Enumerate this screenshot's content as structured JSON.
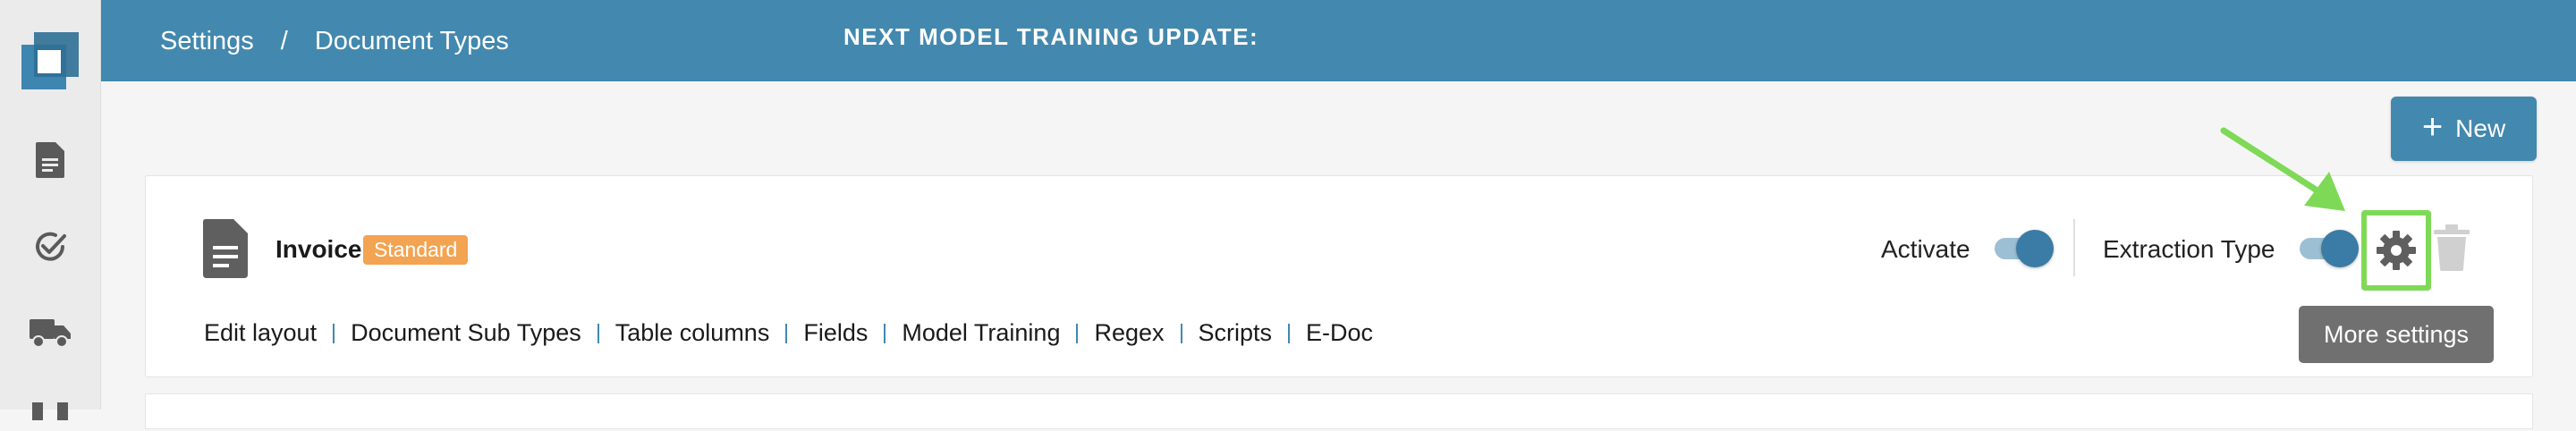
{
  "header": {
    "breadcrumb": [
      "Settings",
      "/",
      "Document Types"
    ],
    "training_title": "NEXT MODEL TRAINING UPDATE:"
  },
  "sidebar": {
    "icons": [
      "document-icon",
      "check-circle-icon",
      "truck-icon",
      "grid-icon"
    ]
  },
  "toolbar": {
    "new_label": "New"
  },
  "document_type": {
    "name": "Invoice",
    "badge": "Standard",
    "activate_label": "Activate",
    "activate_on": true,
    "extraction_label": "Extraction Type",
    "extraction_on": true,
    "links": [
      "Edit layout",
      "Document Sub Types",
      "Table columns",
      "Fields",
      "Model Training",
      "Regex",
      "Scripts",
      "E-Doc"
    ]
  },
  "tooltip": {
    "text": "More settings"
  },
  "colors": {
    "brand": "#4388ae",
    "badge": "#f2a453",
    "highlight": "#7ed957",
    "tooltip": "#707070"
  }
}
